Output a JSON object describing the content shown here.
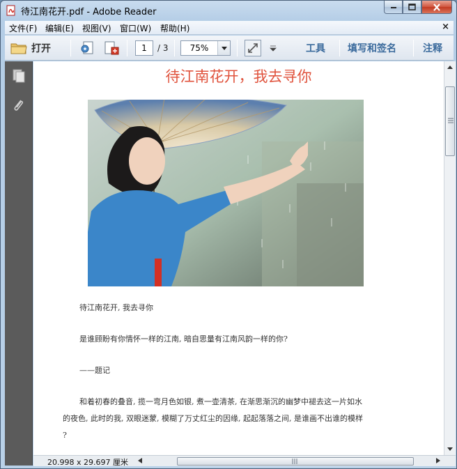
{
  "window": {
    "title": "待江南花开.pdf - Adobe Reader"
  },
  "menu": {
    "items": [
      "文件(F)",
      "编辑(E)",
      "视图(V)",
      "窗口(W)",
      "帮助(H)"
    ],
    "close_glyph": "×"
  },
  "toolbar": {
    "open_label": "打开",
    "page_current": "1",
    "page_total": "/ 3",
    "zoom": "75%",
    "tools_label": "工具",
    "sign_label": "填写和签名",
    "comment_label": "注释"
  },
  "document": {
    "title": "待江南花开，我去寻你",
    "lines": [
      "待江南花开, 我去寻你",
      "是谁顾盼有你情怀一样的江南, 暗自思量有江南风韵一样的你?",
      "——题记",
      "和着初春的叠音, 揽一弯月色如银, 煮一壶清茶, 在渐思渐沉的幽梦中褪去这一片如水",
      "的夜色, 此时的我, 双眼迷蒙, 模糊了万丈红尘的因缘, 起起落落之间, 是谁画不出谁的模样",
      "?"
    ]
  },
  "status": {
    "page_size": "20.998 x 29.697 厘米"
  },
  "colors": {
    "title_red": "#e0533d",
    "tool_blue": "#3a6a9c",
    "nav_gray": "#5b5b5b"
  }
}
